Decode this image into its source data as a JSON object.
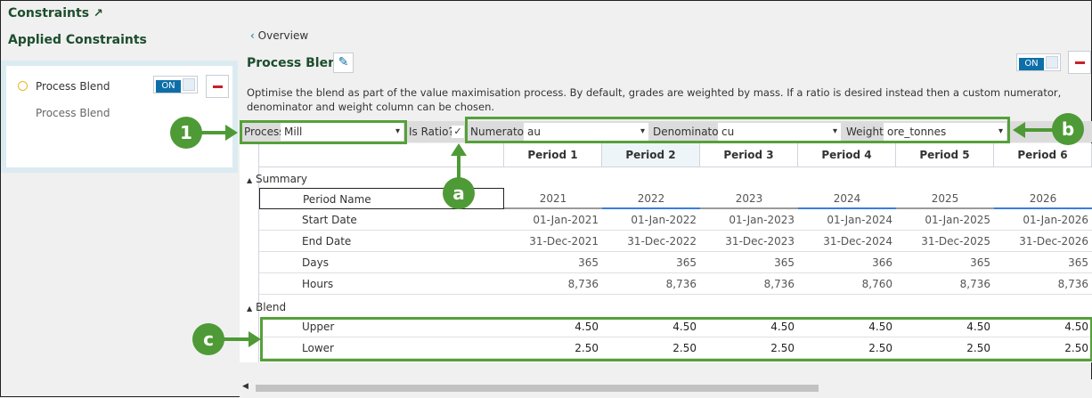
{
  "header": {
    "title": "Constraints",
    "external_icon": "external-link-icon"
  },
  "sidebar": {
    "title": "Applied Constraints",
    "item": {
      "name": "Process Blend",
      "subtitle": "Process Blend",
      "toggle": "ON"
    }
  },
  "main": {
    "back_link": "Overview",
    "title": "Process Blend",
    "toggle": "ON",
    "description": "Optimise the blend as part of the value maximisation process. By default, grades are weighted by mass. If a ratio is desired instead then a custom numerator, denominator and weight column can be chosen.",
    "filters": {
      "process_label": "Process",
      "process_value": "Mill",
      "is_ratio_label": "Is Ratio?",
      "is_ratio_checked": true,
      "numerator_label": "Numerator",
      "numerator_value": "au",
      "denominator_label": "Denominator",
      "denominator_value": "cu",
      "weight_label": "Weight",
      "weight_value": "ore_tonnes"
    },
    "periods": [
      "Period 1",
      "Period 2",
      "Period 3",
      "Period 4",
      "Period 5",
      "Period 6"
    ],
    "summary": {
      "label": "Summary",
      "rows": [
        {
          "label": "Period Name",
          "values": [
            "2021",
            "2022",
            "2023",
            "2024",
            "2025",
            "2026"
          ]
        },
        {
          "label": "Start Date",
          "values": [
            "01-Jan-2021",
            "01-Jan-2022",
            "01-Jan-2023",
            "01-Jan-2024",
            "01-Jan-2025",
            "01-Jan-2026"
          ]
        },
        {
          "label": "End Date",
          "values": [
            "31-Dec-2021",
            "31-Dec-2022",
            "31-Dec-2023",
            "31-Dec-2024",
            "31-Dec-2025",
            "31-Dec-2026"
          ]
        },
        {
          "label": "Days",
          "values": [
            "365",
            "365",
            "365",
            "366",
            "365",
            "365"
          ]
        },
        {
          "label": "Hours",
          "values": [
            "8,736",
            "8,736",
            "8,736",
            "8,760",
            "8,736",
            "8,736"
          ]
        }
      ]
    },
    "blend": {
      "label": "Blend",
      "rows": [
        {
          "label": "Upper",
          "values": [
            "4.50",
            "4.50",
            "4.50",
            "4.50",
            "4.50",
            "4.50"
          ]
        },
        {
          "label": "Lower",
          "values": [
            "2.50",
            "2.50",
            "2.50",
            "2.50",
            "2.50",
            "2.50"
          ]
        }
      ]
    }
  },
  "annotations": {
    "one": "1",
    "a": "a",
    "b": "b",
    "c": "c",
    "color": "#4e9a36"
  }
}
